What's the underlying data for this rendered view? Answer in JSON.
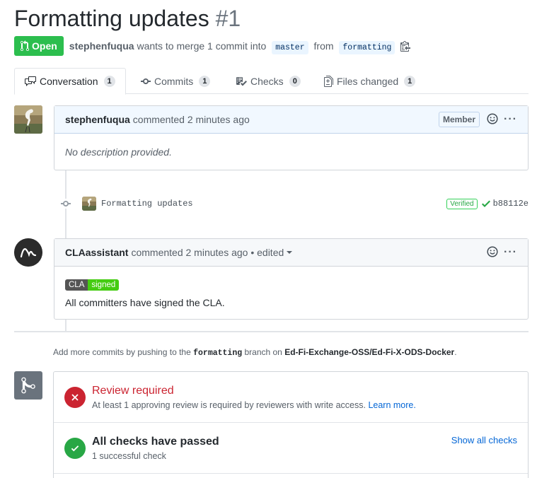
{
  "pr": {
    "title": "Formatting updates",
    "number": "#1",
    "state": "Open",
    "author": "stephenfuqua",
    "merge_text": "wants to merge 1 commit into",
    "base_branch": "master",
    "from_text": "from",
    "head_branch": "formatting"
  },
  "tabs": [
    {
      "label": "Conversation",
      "count": "1",
      "icon": "comment-discussion-icon"
    },
    {
      "label": "Commits",
      "count": "1",
      "icon": "git-commit-icon"
    },
    {
      "label": "Checks",
      "count": "0",
      "icon": "checklist-icon"
    },
    {
      "label": "Files changed",
      "count": "1",
      "icon": "file-diff-icon"
    }
  ],
  "comments": [
    {
      "author": "stephenfuqua",
      "action": "commented 2 minutes ago",
      "role": "Member",
      "body": "No description provided."
    },
    {
      "author": "CLAassistant",
      "action": "commented 2 minutes ago • edited",
      "badge_left": "CLA",
      "badge_right": "signed",
      "body": "All committers have signed the CLA."
    }
  ],
  "commit": {
    "message": "Formatting updates",
    "verified": "Verified",
    "sha": "b88112e"
  },
  "hint": {
    "prefix": "Add more commits by pushing to the",
    "branch": "formatting",
    "middle": "branch on",
    "repo": "Ed-Fi-Exchange-OSS/Ed-Fi-X-ODS-Docker",
    "suffix": "."
  },
  "merge": {
    "review_title": "Review required",
    "review_sub": "At least 1 approving review is required by reviewers with write access.",
    "learn_more": "Learn more.",
    "checks_title": "All checks have passed",
    "checks_sub": "1 successful check",
    "show_checks": "Show all checks"
  },
  "colors": {
    "open_green": "#2cbe4e",
    "error_red": "#cb2431",
    "success_green": "#28a745",
    "link_blue": "#0366d6"
  }
}
